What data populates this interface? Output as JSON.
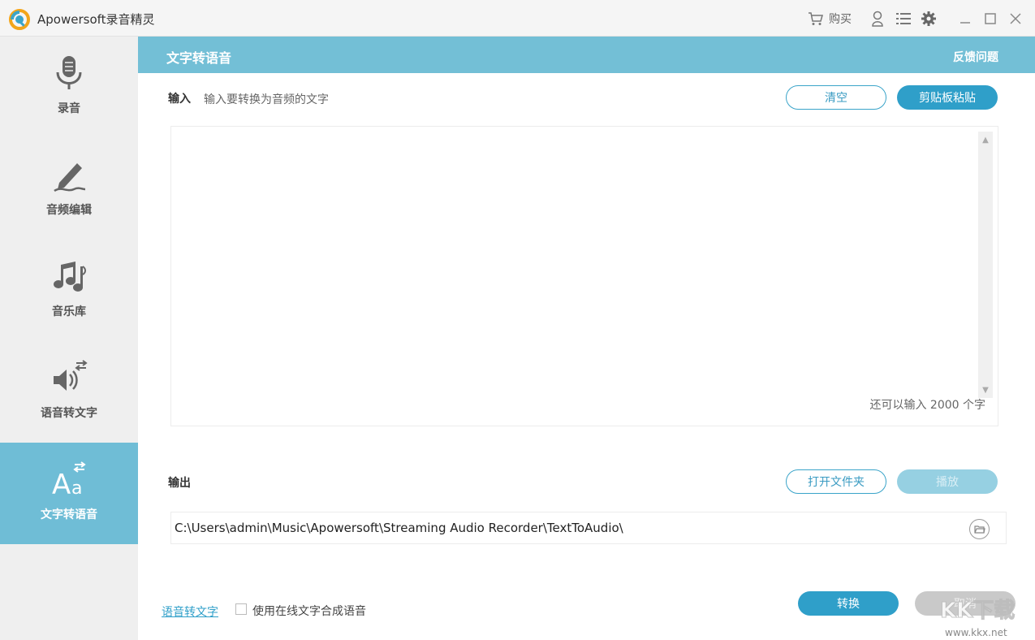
{
  "app": {
    "title": "Apowersoft录音精灵"
  },
  "titlebar": {
    "buy_label": "购买"
  },
  "sidebar": {
    "items": [
      {
        "label": "录音",
        "icon": "microphone-icon"
      },
      {
        "label": "音频编辑",
        "icon": "pen-edit-icon"
      },
      {
        "label": "音乐库",
        "icon": "music-notes-icon"
      },
      {
        "label": "语音转文字",
        "icon": "speaker-convert-icon"
      },
      {
        "label": "文字转语音",
        "icon": "text-convert-icon",
        "active": true
      }
    ]
  },
  "header": {
    "title": "文字转语音",
    "feedback": "反馈问题"
  },
  "input": {
    "label": "输入",
    "hint": "输入要转换为音频的文字",
    "clear_label": "清空",
    "paste_label": "剪贴板粘贴",
    "text": "",
    "counter": "还可以输入 2000 个字"
  },
  "output": {
    "label": "输出",
    "open_folder_label": "打开文件夹",
    "play_label": "播放",
    "path": "C:\\Users\\admin\\Music\\Apowersoft\\Streaming Audio Recorder\\TextToAudio\\"
  },
  "footer": {
    "link_label": "语音转文字",
    "online_synthesis_label": "使用在线文字合成语音",
    "online_synthesis_checked": false,
    "convert_label": "转换",
    "cancel_label": "取消"
  },
  "watermark": {
    "text": "KK下载",
    "url": "www.kkx.net"
  },
  "colors": {
    "accent": "#73bfd6",
    "button": "#2f9fc9",
    "sidebar": "#efefef"
  }
}
